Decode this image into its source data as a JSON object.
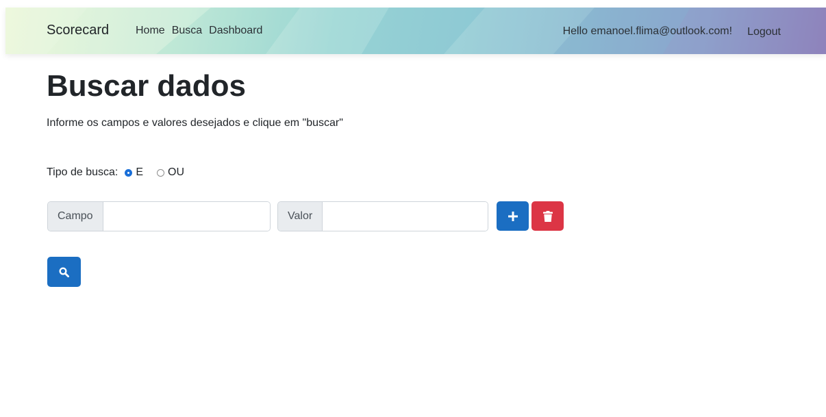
{
  "navbar": {
    "brand": "Scorecard",
    "links": [
      "Home",
      "Busca",
      "Dashboard"
    ],
    "greeting": "Hello emanoel.flima@outlook.com!",
    "logout": "Logout"
  },
  "page": {
    "title": "Buscar dados",
    "subtitle": "Informe os campos e valores desejados e clique em \"buscar\""
  },
  "search_type": {
    "label": "Tipo de busca:",
    "options": [
      "E",
      "OU"
    ],
    "selected": "E"
  },
  "filter_row": {
    "field_label": "Campo",
    "field_value": "",
    "value_label": "Valor",
    "value_value": ""
  },
  "icons": {
    "add": "plus-icon",
    "delete": "trash-icon",
    "search": "search-icon"
  },
  "colors": {
    "primary": "#1b6ec2",
    "danger": "#dc3545"
  }
}
